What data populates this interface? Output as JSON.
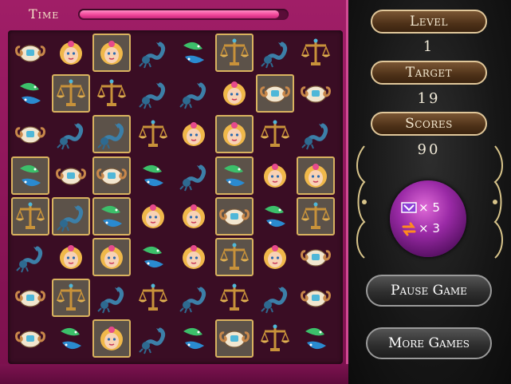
{
  "hud": {
    "time_label": "Time",
    "time_progress": 0.96
  },
  "stats": {
    "level_label": "Level",
    "level_value": "1",
    "target_label": "Target",
    "target_value": "19",
    "scores_label": "Scores",
    "scores_value": "90"
  },
  "powerups": {
    "shuffle_count": "× 5",
    "swap_count": "× 3"
  },
  "buttons": {
    "pause": "Pause Game",
    "more": "More Games"
  },
  "colors": {
    "board": "#a01e67",
    "time_fill": "#f0479a",
    "plaque": "#4e3118",
    "plaque_border": "#e0c79a",
    "selected_border": "#d9b25f"
  },
  "board": {
    "rows": [
      [
        "aries",
        "virgo",
        "virgo",
        "scorpio",
        "pisces",
        "libra",
        "scorpio",
        "libra"
      ],
      [
        "pisces",
        "libra",
        "libra",
        "scorpio",
        "scorpio",
        "virgo",
        "aries",
        "aries"
      ],
      [
        "aries",
        "scorpio",
        "scorpio",
        "libra",
        "virgo",
        "virgo",
        "libra",
        "scorpio"
      ],
      [
        "pisces",
        "aries",
        "aries",
        "pisces",
        "scorpio",
        "pisces",
        "virgo",
        "virgo"
      ],
      [
        "libra",
        "scorpio",
        "pisces",
        "virgo",
        "virgo",
        "aries",
        "pisces",
        "libra"
      ],
      [
        "scorpio",
        "virgo",
        "virgo",
        "pisces",
        "virgo",
        "libra",
        "virgo",
        "aries"
      ],
      [
        "aries",
        "libra",
        "scorpio",
        "libra",
        "scorpio",
        "libra",
        "scorpio",
        "aries"
      ],
      [
        "aries",
        "pisces",
        "virgo",
        "scorpio",
        "pisces",
        "aries",
        "libra",
        "pisces"
      ]
    ],
    "highlighted": [
      [
        0,
        2
      ],
      [
        0,
        5
      ],
      [
        1,
        1
      ],
      [
        1,
        6
      ],
      [
        2,
        2
      ],
      [
        2,
        5
      ],
      [
        3,
        0
      ],
      [
        3,
        2
      ],
      [
        3,
        5
      ],
      [
        3,
        7
      ],
      [
        4,
        0
      ],
      [
        4,
        1
      ],
      [
        4,
        2
      ],
      [
        4,
        5
      ],
      [
        4,
        7
      ],
      [
        5,
        2
      ],
      [
        5,
        5
      ],
      [
        6,
        1
      ],
      [
        7,
        2
      ],
      [
        7,
        5
      ]
    ]
  }
}
